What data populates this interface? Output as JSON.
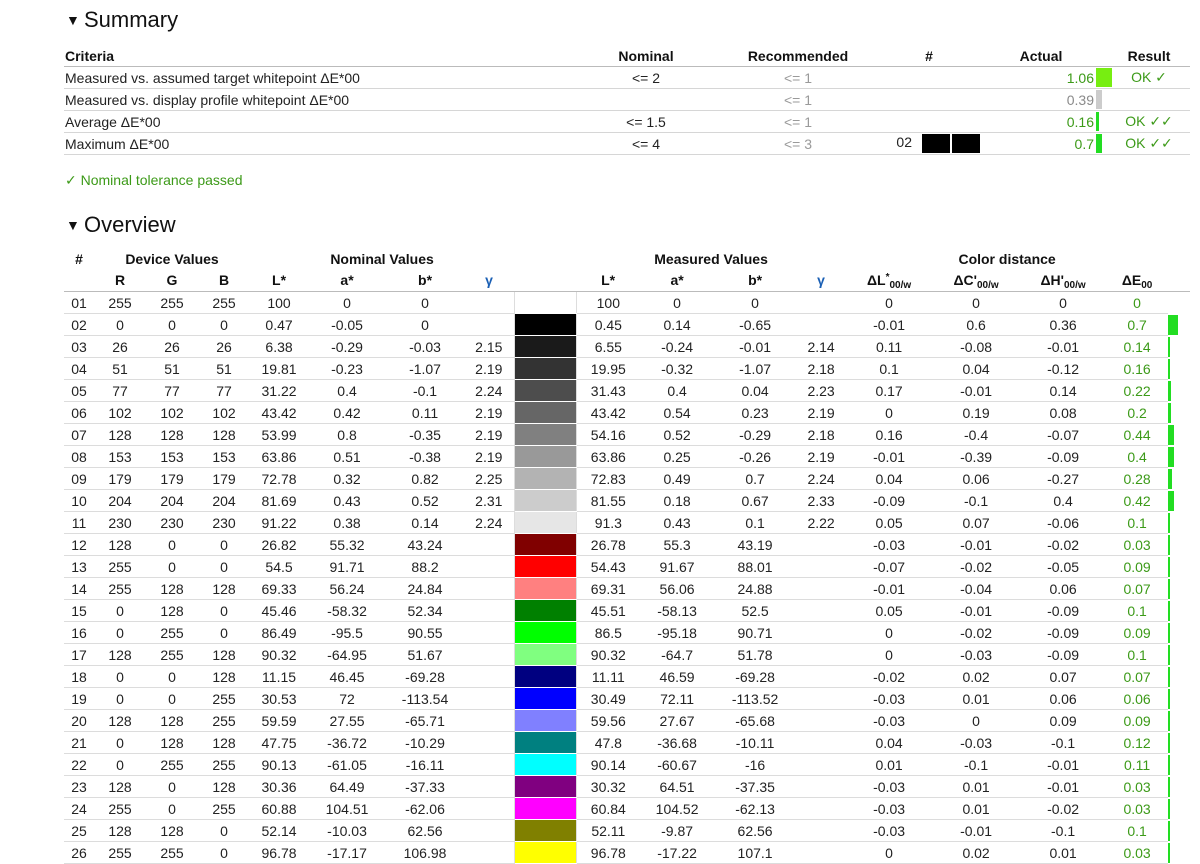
{
  "summary": {
    "heading": "Summary",
    "caret": "▼",
    "columns": {
      "criteria": "Criteria",
      "nominal": "Nominal",
      "recommended": "Recommended",
      "hash": "#",
      "actual": "Actual",
      "result": "Result"
    },
    "rows": [
      {
        "criteria": "Measured vs. assumed target whitepoint ΔE*00",
        "nominal": "<= 2",
        "recommended": "<= 1",
        "hash": "",
        "actual": "1.06",
        "actual_status": "pass",
        "bar_color": "#77ee11",
        "bar_fraction": 1.0,
        "result": "OK ✓"
      },
      {
        "criteria": "Measured vs. display profile whitepoint ΔE*00",
        "nominal": "",
        "recommended": "<= 1",
        "hash": "",
        "actual": "0.39",
        "actual_status": "info",
        "bar_color": "#cccccc",
        "bar_fraction": 0.4,
        "result": ""
      },
      {
        "criteria": "Average ΔE*00",
        "nominal": "<= 1.5",
        "recommended": "<= 1",
        "hash": "",
        "actual": "0.16",
        "actual_status": "pass",
        "bar_color": "#22dd22",
        "bar_fraction": 0.16,
        "result": "OK ✓✓"
      },
      {
        "criteria": "Maximum ΔE*00",
        "nominal": "<= 4",
        "recommended": "<= 3",
        "hash": "02",
        "actual": "0.7",
        "actual_status": "pass",
        "bar_color": "#22dd22",
        "bar_fraction": 0.4,
        "result": "OK ✓✓",
        "patches": [
          "#000000",
          "#000000"
        ]
      }
    ]
  },
  "tolerance_message": "✓ Nominal tolerance passed",
  "overview": {
    "heading": "Overview",
    "caret": "▼",
    "groups": {
      "hash": "#",
      "device": "Device Values",
      "nominal": "Nominal Values",
      "measured": "Measured Values",
      "distance": "Color distance"
    },
    "subcolumns": {
      "R": "R",
      "G": "G",
      "B": "B",
      "nL": "L*",
      "na": "a*",
      "nb": "b*",
      "ngamma": "γ",
      "mL": "L*",
      "ma": "a*",
      "mb": "b*",
      "mgamma": "γ",
      "dL": "ΔL",
      "dC": "ΔC'",
      "dH": "ΔH'",
      "dE": "ΔE",
      "sub_w": "00/w",
      "sub_00": "00",
      "sup_star": "*"
    },
    "rows": [
      {
        "id": "01",
        "r": "255",
        "g": "255",
        "b": "255",
        "nL": "100",
        "na": "0",
        "nb": "0",
        "ng": "",
        "swatch": "#ffffff",
        "mL": "100",
        "ma": "0",
        "mb": "0",
        "mg": "",
        "dL": "0",
        "dC": "0",
        "dH": "0",
        "dE": "0",
        "de_fraction": 0.0
      },
      {
        "id": "02",
        "r": "0",
        "g": "0",
        "b": "0",
        "nL": "0.47",
        "na": "-0.05",
        "nb": "0",
        "ng": "",
        "swatch": "#000000",
        "mL": "0.45",
        "ma": "0.14",
        "mb": "-0.65",
        "mg": "",
        "dL": "-0.01",
        "dC": "0.6",
        "dH": "0.36",
        "dE": "0.7",
        "de_fraction": 1.0
      },
      {
        "id": "03",
        "r": "26",
        "g": "26",
        "b": "26",
        "nL": "6.38",
        "na": "-0.29",
        "nb": "-0.03",
        "ng": "2.15",
        "swatch": "#1a1a1a",
        "mL": "6.55",
        "ma": "-0.24",
        "mb": "-0.01",
        "mg": "2.14",
        "dL": "0.11",
        "dC": "-0.08",
        "dH": "-0.01",
        "dE": "0.14",
        "de_fraction": 0.2
      },
      {
        "id": "04",
        "r": "51",
        "g": "51",
        "b": "51",
        "nL": "19.81",
        "na": "-0.23",
        "nb": "-1.07",
        "ng": "2.19",
        "swatch": "#333333",
        "mL": "19.95",
        "ma": "-0.32",
        "mb": "-1.07",
        "mg": "2.18",
        "dL": "0.1",
        "dC": "0.04",
        "dH": "-0.12",
        "dE": "0.16",
        "de_fraction": 0.23
      },
      {
        "id": "05",
        "r": "77",
        "g": "77",
        "b": "77",
        "nL": "31.22",
        "na": "0.4",
        "nb": "-0.1",
        "ng": "2.24",
        "swatch": "#4d4d4d",
        "mL": "31.43",
        "ma": "0.4",
        "mb": "0.04",
        "mg": "2.23",
        "dL": "0.17",
        "dC": "-0.01",
        "dH": "0.14",
        "dE": "0.22",
        "de_fraction": 0.31
      },
      {
        "id": "06",
        "r": "102",
        "g": "102",
        "b": "102",
        "nL": "43.42",
        "na": "0.42",
        "nb": "0.11",
        "ng": "2.19",
        "swatch": "#666666",
        "mL": "43.42",
        "ma": "0.54",
        "mb": "0.23",
        "mg": "2.19",
        "dL": "0",
        "dC": "0.19",
        "dH": "0.08",
        "dE": "0.2",
        "de_fraction": 0.29
      },
      {
        "id": "07",
        "r": "128",
        "g": "128",
        "b": "128",
        "nL": "53.99",
        "na": "0.8",
        "nb": "-0.35",
        "ng": "2.19",
        "swatch": "#808080",
        "mL": "54.16",
        "ma": "0.52",
        "mb": "-0.29",
        "mg": "2.18",
        "dL": "0.16",
        "dC": "-0.4",
        "dH": "-0.07",
        "dE": "0.44",
        "de_fraction": 0.63
      },
      {
        "id": "08",
        "r": "153",
        "g": "153",
        "b": "153",
        "nL": "63.86",
        "na": "0.51",
        "nb": "-0.38",
        "ng": "2.19",
        "swatch": "#999999",
        "mL": "63.86",
        "ma": "0.25",
        "mb": "-0.26",
        "mg": "2.19",
        "dL": "-0.01",
        "dC": "-0.39",
        "dH": "-0.09",
        "dE": "0.4",
        "de_fraction": 0.57
      },
      {
        "id": "09",
        "r": "179",
        "g": "179",
        "b": "179",
        "nL": "72.78",
        "na": "0.32",
        "nb": "0.82",
        "ng": "2.25",
        "swatch": "#b3b3b3",
        "mL": "72.83",
        "ma": "0.49",
        "mb": "0.7",
        "mg": "2.24",
        "dL": "0.04",
        "dC": "0.06",
        "dH": "-0.27",
        "dE": "0.28",
        "de_fraction": 0.4
      },
      {
        "id": "10",
        "r": "204",
        "g": "204",
        "b": "204",
        "nL": "81.69",
        "na": "0.43",
        "nb": "0.52",
        "ng": "2.31",
        "swatch": "#cccccc",
        "mL": "81.55",
        "ma": "0.18",
        "mb": "0.67",
        "mg": "2.33",
        "dL": "-0.09",
        "dC": "-0.1",
        "dH": "0.4",
        "dE": "0.42",
        "de_fraction": 0.6
      },
      {
        "id": "11",
        "r": "230",
        "g": "230",
        "b": "230",
        "nL": "91.22",
        "na": "0.38",
        "nb": "0.14",
        "ng": "2.24",
        "swatch": "#e6e6e6",
        "mL": "91.3",
        "ma": "0.43",
        "mb": "0.1",
        "mg": "2.22",
        "dL": "0.05",
        "dC": "0.07",
        "dH": "-0.06",
        "dE": "0.1",
        "de_fraction": 0.14
      },
      {
        "id": "12",
        "r": "128",
        "g": "0",
        "b": "0",
        "nL": "26.82",
        "na": "55.32",
        "nb": "43.24",
        "ng": "",
        "swatch": "#800000",
        "mL": "26.78",
        "ma": "55.3",
        "mb": "43.19",
        "mg": "",
        "dL": "-0.03",
        "dC": "-0.01",
        "dH": "-0.02",
        "dE": "0.03",
        "de_fraction": 0.04
      },
      {
        "id": "13",
        "r": "255",
        "g": "0",
        "b": "0",
        "nL": "54.5",
        "na": "91.71",
        "nb": "88.2",
        "ng": "",
        "swatch": "#ff0000",
        "mL": "54.43",
        "ma": "91.67",
        "mb": "88.01",
        "mg": "",
        "dL": "-0.07",
        "dC": "-0.02",
        "dH": "-0.05",
        "dE": "0.09",
        "de_fraction": 0.13
      },
      {
        "id": "14",
        "r": "255",
        "g": "128",
        "b": "128",
        "nL": "69.33",
        "na": "56.24",
        "nb": "24.84",
        "ng": "",
        "swatch": "#ff8080",
        "mL": "69.31",
        "ma": "56.06",
        "mb": "24.88",
        "mg": "",
        "dL": "-0.01",
        "dC": "-0.04",
        "dH": "0.06",
        "dE": "0.07",
        "de_fraction": 0.1
      },
      {
        "id": "15",
        "r": "0",
        "g": "128",
        "b": "0",
        "nL": "45.46",
        "na": "-58.32",
        "nb": "52.34",
        "ng": "",
        "swatch": "#008000",
        "mL": "45.51",
        "ma": "-58.13",
        "mb": "52.5",
        "mg": "",
        "dL": "0.05",
        "dC": "-0.01",
        "dH": "-0.09",
        "dE": "0.1",
        "de_fraction": 0.14
      },
      {
        "id": "16",
        "r": "0",
        "g": "255",
        "b": "0",
        "nL": "86.49",
        "na": "-95.5",
        "nb": "90.55",
        "ng": "",
        "swatch": "#00ff00",
        "mL": "86.5",
        "ma": "-95.18",
        "mb": "90.71",
        "mg": "",
        "dL": "0",
        "dC": "-0.02",
        "dH": "-0.09",
        "dE": "0.09",
        "de_fraction": 0.13
      },
      {
        "id": "17",
        "r": "128",
        "g": "255",
        "b": "128",
        "nL": "90.32",
        "na": "-64.95",
        "nb": "51.67",
        "ng": "",
        "swatch": "#80ff80",
        "mL": "90.32",
        "ma": "-64.7",
        "mb": "51.78",
        "mg": "",
        "dL": "0",
        "dC": "-0.03",
        "dH": "-0.09",
        "dE": "0.1",
        "de_fraction": 0.14
      },
      {
        "id": "18",
        "r": "0",
        "g": "0",
        "b": "128",
        "nL": "11.15",
        "na": "46.45",
        "nb": "-69.28",
        "ng": "",
        "swatch": "#000080",
        "mL": "11.11",
        "ma": "46.59",
        "mb": "-69.28",
        "mg": "",
        "dL": "-0.02",
        "dC": "0.02",
        "dH": "0.07",
        "dE": "0.07",
        "de_fraction": 0.1
      },
      {
        "id": "19",
        "r": "0",
        "g": "0",
        "b": "255",
        "nL": "30.53",
        "na": "72",
        "nb": "-113.54",
        "ng": "",
        "swatch": "#0000ff",
        "mL": "30.49",
        "ma": "72.11",
        "mb": "-113.52",
        "mg": "",
        "dL": "-0.03",
        "dC": "0.01",
        "dH": "0.06",
        "dE": "0.06",
        "de_fraction": 0.09
      },
      {
        "id": "20",
        "r": "128",
        "g": "128",
        "b": "255",
        "nL": "59.59",
        "na": "27.55",
        "nb": "-65.71",
        "ng": "",
        "swatch": "#8080ff",
        "mL": "59.56",
        "ma": "27.67",
        "mb": "-65.68",
        "mg": "",
        "dL": "-0.03",
        "dC": "0",
        "dH": "0.09",
        "dE": "0.09",
        "de_fraction": 0.13
      },
      {
        "id": "21",
        "r": "0",
        "g": "128",
        "b": "128",
        "nL": "47.75",
        "na": "-36.72",
        "nb": "-10.29",
        "ng": "",
        "swatch": "#008080",
        "mL": "47.8",
        "ma": "-36.68",
        "mb": "-10.11",
        "mg": "",
        "dL": "0.04",
        "dC": "-0.03",
        "dH": "-0.1",
        "dE": "0.12",
        "de_fraction": 0.17
      },
      {
        "id": "22",
        "r": "0",
        "g": "255",
        "b": "255",
        "nL": "90.13",
        "na": "-61.05",
        "nb": "-16.11",
        "ng": "",
        "swatch": "#00ffff",
        "mL": "90.14",
        "ma": "-60.67",
        "mb": "-16",
        "mg": "",
        "dL": "0.01",
        "dC": "-0.1",
        "dH": "-0.01",
        "dE": "0.11",
        "de_fraction": 0.16
      },
      {
        "id": "23",
        "r": "128",
        "g": "0",
        "b": "128",
        "nL": "30.36",
        "na": "64.49",
        "nb": "-37.33",
        "ng": "",
        "swatch": "#800080",
        "mL": "30.32",
        "ma": "64.51",
        "mb": "-37.35",
        "mg": "",
        "dL": "-0.03",
        "dC": "0.01",
        "dH": "-0.01",
        "dE": "0.03",
        "de_fraction": 0.04
      },
      {
        "id": "24",
        "r": "255",
        "g": "0",
        "b": "255",
        "nL": "60.88",
        "na": "104.51",
        "nb": "-62.06",
        "ng": "",
        "swatch": "#ff00ff",
        "mL": "60.84",
        "ma": "104.52",
        "mb": "-62.13",
        "mg": "",
        "dL": "-0.03",
        "dC": "0.01",
        "dH": "-0.02",
        "dE": "0.03",
        "de_fraction": 0.04
      },
      {
        "id": "25",
        "r": "128",
        "g": "128",
        "b": "0",
        "nL": "52.14",
        "na": "-10.03",
        "nb": "62.56",
        "ng": "",
        "swatch": "#808000",
        "mL": "52.11",
        "ma": "-9.87",
        "mb": "62.56",
        "mg": "",
        "dL": "-0.03",
        "dC": "-0.01",
        "dH": "-0.1",
        "dE": "0.1",
        "de_fraction": 0.14
      },
      {
        "id": "26",
        "r": "255",
        "g": "255",
        "b": "0",
        "nL": "96.78",
        "na": "-17.17",
        "nb": "106.98",
        "ng": "",
        "swatch": "#ffff00",
        "mL": "96.78",
        "ma": "-17.22",
        "mb": "107.1",
        "mg": "",
        "dL": "0",
        "dC": "0.02",
        "dH": "0.01",
        "dE": "0.03",
        "de_fraction": 0.04
      }
    ]
  }
}
